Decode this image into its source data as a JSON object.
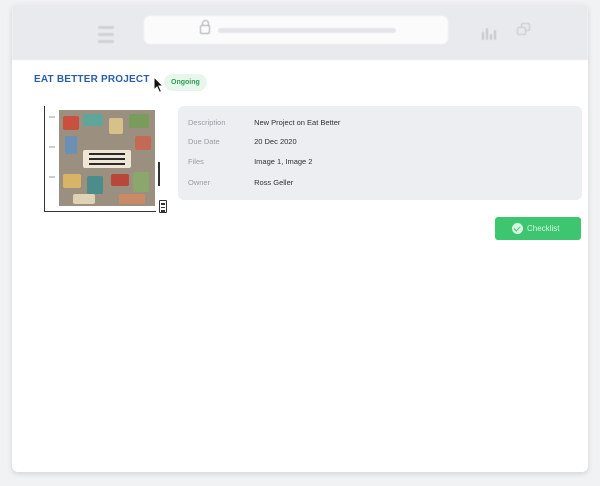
{
  "project": {
    "title": "EAT BETTER PROJECT",
    "status": "Ongoing"
  },
  "details": [
    {
      "label": "Description",
      "value": "New Project on Eat Better"
    },
    {
      "label": "Due Date",
      "value": "20 Dec 2020"
    },
    {
      "label": "Files",
      "value": "Image 1, Image 2"
    },
    {
      "label": "Owner",
      "value": "Ross Geller"
    }
  ],
  "actions": {
    "checklist_label": "Checklist"
  },
  "colors": {
    "accent": "#3ec56f",
    "title": "#2a5ea8",
    "badge_bg": "#e7f7ec",
    "badge_text": "#2f9e55"
  }
}
